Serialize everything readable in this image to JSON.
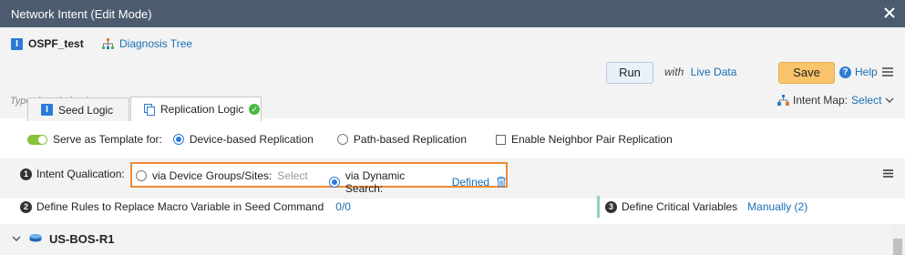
{
  "window": {
    "title": "Network Intent (Edit Mode)"
  },
  "header": {
    "intent_name": "OSPF_test",
    "diagnosis_tree": "Diagnosis Tree",
    "run_label": "Run",
    "with_label": "with",
    "live_data": "Live Data",
    "save_label": "Save",
    "help_label": "Help",
    "description_placeholder": "Type description here...",
    "intent_map_label": "Intent Map:",
    "intent_map_value": "Select"
  },
  "tabs": [
    {
      "label": "Seed Logic",
      "active": false
    },
    {
      "label": "Replication Logic",
      "active": true
    }
  ],
  "template": {
    "serve_label": "Serve as Template for:",
    "serve_enabled": true,
    "device_based": "Device-based Replication",
    "path_based": "Path-based Replication",
    "selected": "Device-based Replication",
    "neighbor_pair": "Enable Neighbor Pair Replication",
    "neighbor_pair_checked": false
  },
  "qualification": {
    "number": "1",
    "label": "Intent Qualication:",
    "option_groups": "via Device Groups/Sites:",
    "option_groups_value": "Select",
    "option_search": "via Dynamic Search:",
    "option_search_value": "Defined",
    "selected": "via Dynamic Search:"
  },
  "rules": {
    "number": "2",
    "label": "Define Rules to Replace Macro Variable in Seed Command",
    "count": "0/0"
  },
  "critical": {
    "number": "3",
    "label": "Define Critical Variables",
    "value": "Manually (2)"
  },
  "device": {
    "name": "US-BOS-R1"
  },
  "colors": {
    "titlebar": "#4c5c6e",
    "accent": "#2b7bd6",
    "save": "#f9c46b",
    "highlight_border": "#f08a34",
    "toggle_on": "#86c23b"
  }
}
